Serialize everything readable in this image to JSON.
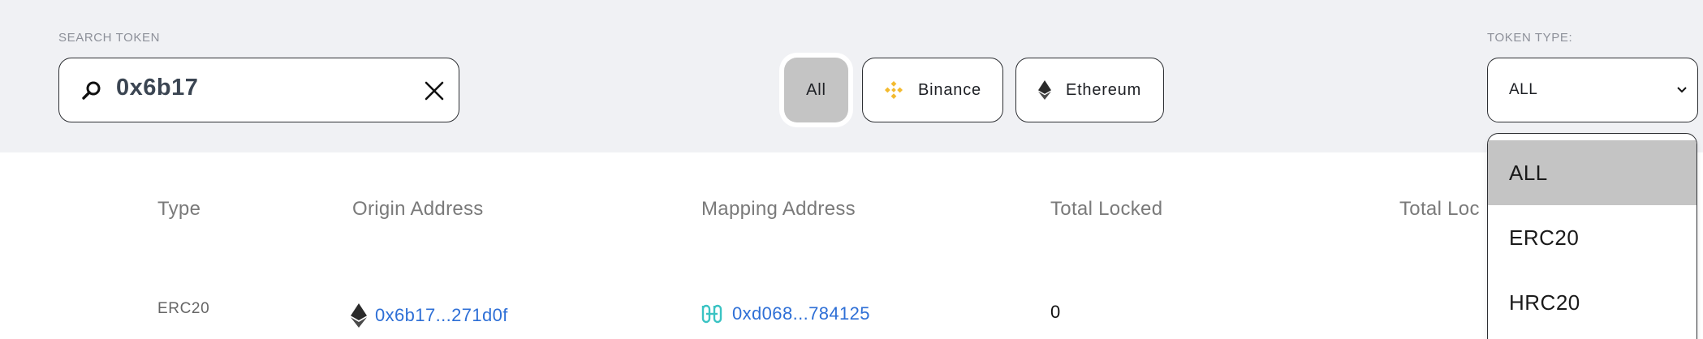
{
  "search": {
    "label": "SEARCH TOKEN",
    "value": "0x6b17"
  },
  "networks": {
    "all": "All",
    "binance": "Binance",
    "ethereum": "Ethereum",
    "selected": "All"
  },
  "token_type": {
    "label": "TOKEN TYPE:",
    "selected": "ALL",
    "options": [
      "ALL",
      "ERC20",
      "HRC20"
    ]
  },
  "table": {
    "headers": [
      "Type",
      "Origin Address",
      "Mapping Address",
      "Total Locked",
      "Total Loc"
    ],
    "rows": [
      {
        "type": "ERC20",
        "origin_address": "0x6b17...271d0f",
        "mapping_address": "0xd068...784125",
        "total_locked": "0"
      }
    ]
  },
  "colors": {
    "link": "#2e6fd6",
    "binance_yellow": "#f3ba2f",
    "harmony_teal": "#3ac3c3",
    "selected_bg": "#c4c4c4",
    "bar_bg": "#f0f1f4"
  },
  "icons": {
    "search": "search-icon",
    "clear": "close-icon",
    "binance": "binance-icon",
    "ethereum": "ethereum-icon",
    "dropdown": "chevron-down-icon",
    "harmony": "harmony-icon"
  }
}
